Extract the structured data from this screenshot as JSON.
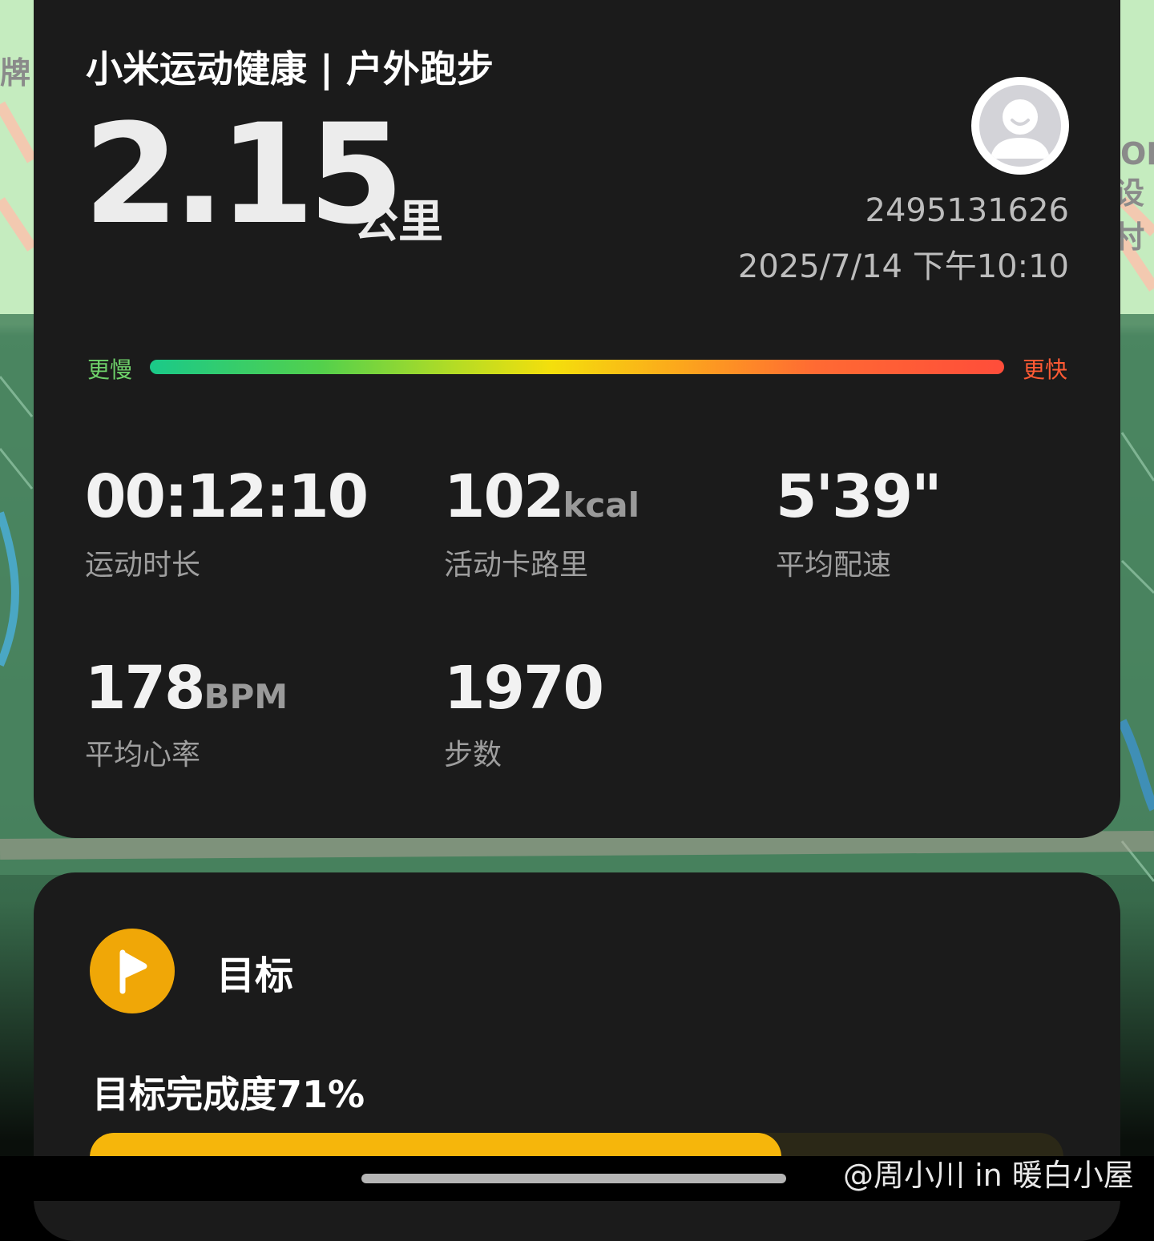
{
  "app": {
    "title": "小米运动健康 | 户外跑步"
  },
  "summary": {
    "distance_value": "2.15",
    "distance_unit": "公里",
    "user_id": "2495131626",
    "datetime": "2025/7/14 下午10:10"
  },
  "pace_scale": {
    "slow_label": "更慢",
    "fast_label": "更快"
  },
  "stats": {
    "duration": {
      "value": "00:12:10",
      "unit": "",
      "label": "运动时长"
    },
    "calories": {
      "value": "102",
      "unit": "kcal",
      "label": "活动卡路里"
    },
    "pace": {
      "value": "5'39\"",
      "unit": "",
      "label": "平均配速"
    },
    "heart_rate": {
      "value": "178",
      "unit": "BPM",
      "label": "平均心率"
    },
    "steps": {
      "value": "1970",
      "unit": "",
      "label": "步数"
    }
  },
  "goal": {
    "title": "目标",
    "progress_text": "目标完成度71%",
    "progress_fraction": 0.71,
    "accent_color": "#f6b60b"
  },
  "map": {
    "label_left": "牌",
    "label_right_1": "OPI",
    "label_right_2": "设村"
  },
  "watermark": "@周小川 in 暖白小屋",
  "colors": {
    "card_bg": "#1b1b1b",
    "slow_color": "#6ed16a",
    "fast_color": "#ff5a34"
  },
  "icons": {
    "avatar": "default-avatar-icon",
    "goal": "flag-icon"
  }
}
